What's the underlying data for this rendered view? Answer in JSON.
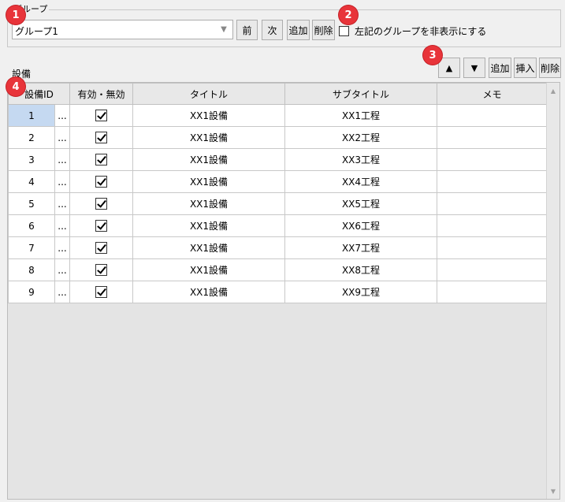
{
  "group": {
    "legend": "グループ",
    "selected": "グループ1",
    "prev_label": "前",
    "next_label": "次",
    "add_label": "追加",
    "delete_label": "削除",
    "hide_label": "左記のグループを非表示にする"
  },
  "equipment": {
    "section_label": "設備",
    "up_label": "▲",
    "down_label": "▼",
    "add_label": "追加",
    "insert_label": "挿入",
    "delete_label": "削除",
    "columns": {
      "id": "設備ID",
      "enabled": "有効・無効",
      "title": "タイトル",
      "subtitle": "サブタイトル",
      "memo": "メモ"
    },
    "rows": [
      {
        "id": "1",
        "more": "...",
        "title": "XX1設備",
        "subtitle": "XX1工程",
        "memo": ""
      },
      {
        "id": "2",
        "more": "...",
        "title": "XX1設備",
        "subtitle": "XX2工程",
        "memo": ""
      },
      {
        "id": "3",
        "more": "...",
        "title": "XX1設備",
        "subtitle": "XX3工程",
        "memo": ""
      },
      {
        "id": "4",
        "more": "...",
        "title": "XX1設備",
        "subtitle": "XX4工程",
        "memo": ""
      },
      {
        "id": "5",
        "more": "...",
        "title": "XX1設備",
        "subtitle": "XX5工程",
        "memo": ""
      },
      {
        "id": "6",
        "more": "...",
        "title": "XX1設備",
        "subtitle": "XX6工程",
        "memo": ""
      },
      {
        "id": "7",
        "more": "...",
        "title": "XX1設備",
        "subtitle": "XX7工程",
        "memo": ""
      },
      {
        "id": "8",
        "more": "...",
        "title": "XX1設備",
        "subtitle": "XX8工程",
        "memo": ""
      },
      {
        "id": "9",
        "more": "...",
        "title": "XX1設備",
        "subtitle": "XX9工程",
        "memo": ""
      }
    ]
  },
  "markers": [
    "1",
    "2",
    "3",
    "4"
  ],
  "colors": {
    "marker": "#e8343a",
    "selected_cell": "#c5d9f1"
  }
}
